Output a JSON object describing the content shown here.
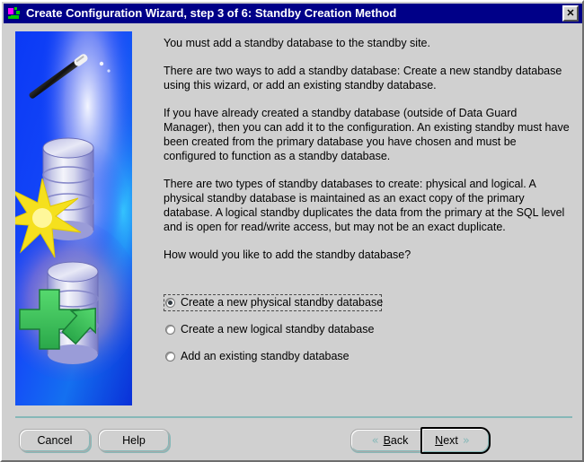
{
  "window": {
    "title": "Create Configuration Wizard, step 3 of 6: Standby Creation Method",
    "icon_name": "wizard-app-icon",
    "close_label": "✕",
    "title_bar_color": "#000088",
    "title_text_color": "#ffffff",
    "face_color": "#d0d0d0",
    "accent_color": "#86b8b8"
  },
  "illustration": {
    "name": "standby-database-wizard-illustration",
    "alt": "Magic wand with glowing trail above a database cylinder, a yellow starburst, and a second database cylinder with a green plus sign and green arrow"
  },
  "body": {
    "paragraphs": [
      "You must add a standby database to the standby site.",
      "There are two ways to add a standby database: Create a new standby database using this wizard, or add an existing standby database.",
      "If you have already created a standby database (outside of Data Guard Manager), then you can add it to the configuration. An existing standby must have been created from the primary database you have chosen and must be configured to function as a standby database.",
      "There are two types of standby databases to create: physical and logical. A physical standby database is maintained as an exact copy of the primary database. A logical standby duplicates the data from the primary at the SQL level and is open for read/write access, but may not be an exact duplicate."
    ],
    "question": "How would you like to add the standby database?"
  },
  "radios": {
    "name": "standby-creation-method",
    "options": [
      {
        "label": "Create a new physical standby database",
        "selected": true,
        "focused": true
      },
      {
        "label": "Create a new logical standby database",
        "selected": false,
        "focused": false
      },
      {
        "label": "Add an existing standby database",
        "selected": false,
        "focused": false
      }
    ]
  },
  "buttons": {
    "cancel": "Cancel",
    "help": "Help",
    "back": "Back",
    "back_mnemonic": "B",
    "back_rest": "ack",
    "next": "Next",
    "next_mnemonic": "N",
    "next_rest": "ext",
    "back_chevron": "«",
    "next_chevron": "»"
  }
}
